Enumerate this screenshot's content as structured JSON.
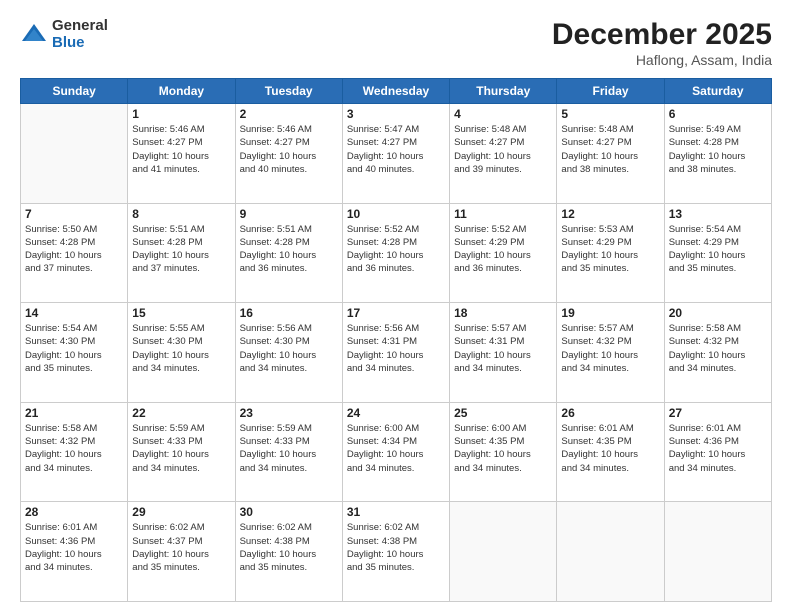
{
  "header": {
    "logo_general": "General",
    "logo_blue": "Blue",
    "month_title": "December 2025",
    "location": "Haflong, Assam, India"
  },
  "days_of_week": [
    "Sunday",
    "Monday",
    "Tuesday",
    "Wednesday",
    "Thursday",
    "Friday",
    "Saturday"
  ],
  "weeks": [
    [
      {
        "day": "",
        "info": ""
      },
      {
        "day": "1",
        "info": "Sunrise: 5:46 AM\nSunset: 4:27 PM\nDaylight: 10 hours\nand 41 minutes."
      },
      {
        "day": "2",
        "info": "Sunrise: 5:46 AM\nSunset: 4:27 PM\nDaylight: 10 hours\nand 40 minutes."
      },
      {
        "day": "3",
        "info": "Sunrise: 5:47 AM\nSunset: 4:27 PM\nDaylight: 10 hours\nand 40 minutes."
      },
      {
        "day": "4",
        "info": "Sunrise: 5:48 AM\nSunset: 4:27 PM\nDaylight: 10 hours\nand 39 minutes."
      },
      {
        "day": "5",
        "info": "Sunrise: 5:48 AM\nSunset: 4:27 PM\nDaylight: 10 hours\nand 38 minutes."
      },
      {
        "day": "6",
        "info": "Sunrise: 5:49 AM\nSunset: 4:28 PM\nDaylight: 10 hours\nand 38 minutes."
      }
    ],
    [
      {
        "day": "7",
        "info": "Sunrise: 5:50 AM\nSunset: 4:28 PM\nDaylight: 10 hours\nand 37 minutes."
      },
      {
        "day": "8",
        "info": "Sunrise: 5:51 AM\nSunset: 4:28 PM\nDaylight: 10 hours\nand 37 minutes."
      },
      {
        "day": "9",
        "info": "Sunrise: 5:51 AM\nSunset: 4:28 PM\nDaylight: 10 hours\nand 36 minutes."
      },
      {
        "day": "10",
        "info": "Sunrise: 5:52 AM\nSunset: 4:28 PM\nDaylight: 10 hours\nand 36 minutes."
      },
      {
        "day": "11",
        "info": "Sunrise: 5:52 AM\nSunset: 4:29 PM\nDaylight: 10 hours\nand 36 minutes."
      },
      {
        "day": "12",
        "info": "Sunrise: 5:53 AM\nSunset: 4:29 PM\nDaylight: 10 hours\nand 35 minutes."
      },
      {
        "day": "13",
        "info": "Sunrise: 5:54 AM\nSunset: 4:29 PM\nDaylight: 10 hours\nand 35 minutes."
      }
    ],
    [
      {
        "day": "14",
        "info": "Sunrise: 5:54 AM\nSunset: 4:30 PM\nDaylight: 10 hours\nand 35 minutes."
      },
      {
        "day": "15",
        "info": "Sunrise: 5:55 AM\nSunset: 4:30 PM\nDaylight: 10 hours\nand 34 minutes."
      },
      {
        "day": "16",
        "info": "Sunrise: 5:56 AM\nSunset: 4:30 PM\nDaylight: 10 hours\nand 34 minutes."
      },
      {
        "day": "17",
        "info": "Sunrise: 5:56 AM\nSunset: 4:31 PM\nDaylight: 10 hours\nand 34 minutes."
      },
      {
        "day": "18",
        "info": "Sunrise: 5:57 AM\nSunset: 4:31 PM\nDaylight: 10 hours\nand 34 minutes."
      },
      {
        "day": "19",
        "info": "Sunrise: 5:57 AM\nSunset: 4:32 PM\nDaylight: 10 hours\nand 34 minutes."
      },
      {
        "day": "20",
        "info": "Sunrise: 5:58 AM\nSunset: 4:32 PM\nDaylight: 10 hours\nand 34 minutes."
      }
    ],
    [
      {
        "day": "21",
        "info": "Sunrise: 5:58 AM\nSunset: 4:32 PM\nDaylight: 10 hours\nand 34 minutes."
      },
      {
        "day": "22",
        "info": "Sunrise: 5:59 AM\nSunset: 4:33 PM\nDaylight: 10 hours\nand 34 minutes."
      },
      {
        "day": "23",
        "info": "Sunrise: 5:59 AM\nSunset: 4:33 PM\nDaylight: 10 hours\nand 34 minutes."
      },
      {
        "day": "24",
        "info": "Sunrise: 6:00 AM\nSunset: 4:34 PM\nDaylight: 10 hours\nand 34 minutes."
      },
      {
        "day": "25",
        "info": "Sunrise: 6:00 AM\nSunset: 4:35 PM\nDaylight: 10 hours\nand 34 minutes."
      },
      {
        "day": "26",
        "info": "Sunrise: 6:01 AM\nSunset: 4:35 PM\nDaylight: 10 hours\nand 34 minutes."
      },
      {
        "day": "27",
        "info": "Sunrise: 6:01 AM\nSunset: 4:36 PM\nDaylight: 10 hours\nand 34 minutes."
      }
    ],
    [
      {
        "day": "28",
        "info": "Sunrise: 6:01 AM\nSunset: 4:36 PM\nDaylight: 10 hours\nand 34 minutes."
      },
      {
        "day": "29",
        "info": "Sunrise: 6:02 AM\nSunset: 4:37 PM\nDaylight: 10 hours\nand 35 minutes."
      },
      {
        "day": "30",
        "info": "Sunrise: 6:02 AM\nSunset: 4:38 PM\nDaylight: 10 hours\nand 35 minutes."
      },
      {
        "day": "31",
        "info": "Sunrise: 6:02 AM\nSunset: 4:38 PM\nDaylight: 10 hours\nand 35 minutes."
      },
      {
        "day": "",
        "info": ""
      },
      {
        "day": "",
        "info": ""
      },
      {
        "day": "",
        "info": ""
      }
    ]
  ]
}
